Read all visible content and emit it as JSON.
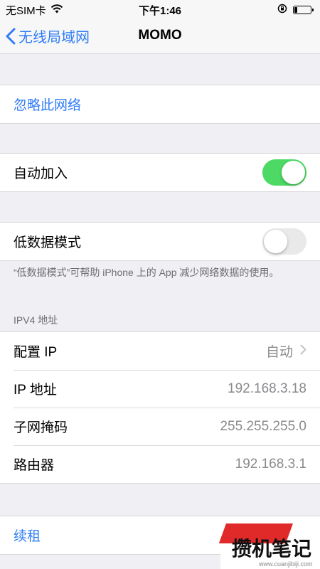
{
  "status_bar": {
    "carrier": "无SIM卡",
    "time": "下午1:46",
    "battery_level": 0.2
  },
  "nav": {
    "back_label": "无线局域网",
    "title": "MOMO"
  },
  "forget": {
    "label": "忽略此网络"
  },
  "auto_join": {
    "label": "自动加入",
    "enabled": true
  },
  "low_data": {
    "label": "低数据模式",
    "enabled": false,
    "footnote": "“低数据模式”可帮助 iPhone 上的 App 减少网络数据的使用。"
  },
  "ipv4": {
    "header": "IPV4 地址",
    "rows": [
      {
        "label": "配置 IP",
        "value": "自动"
      },
      {
        "label": "IP 地址",
        "value": "192.168.3.18"
      },
      {
        "label": "子网掩码",
        "value": "255.255.255.0"
      },
      {
        "label": "路由器",
        "value": "192.168.3.1"
      }
    ]
  },
  "renew": {
    "label": "续租"
  },
  "watermark": {
    "text": "攒机笔记",
    "url": "www.cuanjibiji.com"
  },
  "colors": {
    "accent": "#2f7cf6",
    "toggle_on": "#4cd964",
    "background": "#efeff4"
  }
}
